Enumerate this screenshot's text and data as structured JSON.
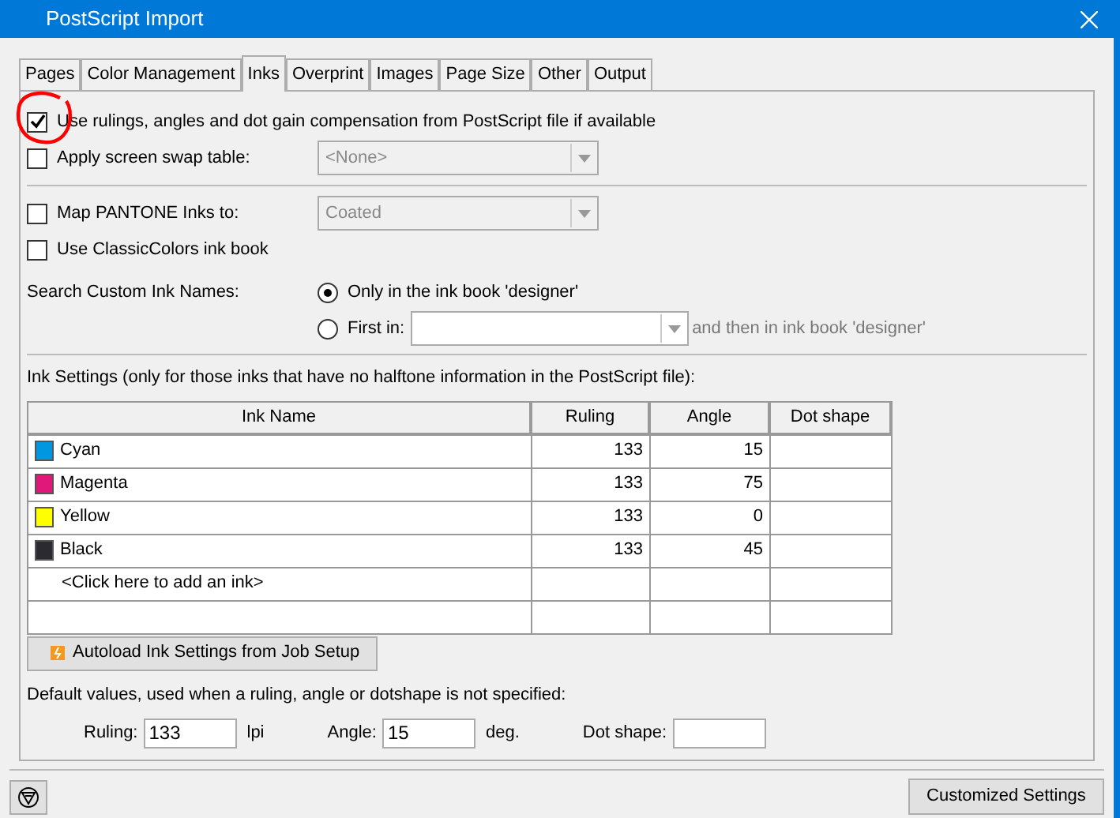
{
  "window": {
    "title": "PostScript Import"
  },
  "tabs": [
    {
      "label": "Pages",
      "selected": false
    },
    {
      "label": "Color Management",
      "selected": false
    },
    {
      "label": "Inks",
      "selected": true
    },
    {
      "label": "Overprint",
      "selected": false
    },
    {
      "label": "Images",
      "selected": false
    },
    {
      "label": "Page Size",
      "selected": false
    },
    {
      "label": "Other",
      "selected": false
    },
    {
      "label": "Output",
      "selected": false
    }
  ],
  "use_rulings": {
    "label": "Use rulings, angles and dot gain compensation from PostScript file if available",
    "checked": true
  },
  "screen_swap": {
    "label": "Apply screen swap table:",
    "checked": false,
    "dropdown": "<None>"
  },
  "map_pantone": {
    "label": "Map PANTONE Inks to:",
    "checked": false,
    "dropdown": "Coated"
  },
  "classic_colors": {
    "label": "Use ClassicColors ink book",
    "checked": false
  },
  "search_custom": {
    "label": "Search Custom Ink Names:",
    "options": [
      {
        "label": "Only in the ink book 'designer'",
        "selected": true
      },
      {
        "label": "First in:",
        "selected": false
      }
    ],
    "suffix": "and then in ink book 'designer'"
  },
  "ink_settings": {
    "label": "Ink Settings (only for those inks that have no halftone information in the PostScript file):",
    "columns": [
      "Ink Name",
      "Ruling",
      "Angle",
      "Dot shape"
    ],
    "rows": [
      {
        "name": "Cyan",
        "color": "#0096e0",
        "ruling": "133",
        "angle": "15"
      },
      {
        "name": "Magenta",
        "color": "#e0187a",
        "ruling": "133",
        "angle": "75"
      },
      {
        "name": "Yellow",
        "color": "#ffff00",
        "ruling": "133",
        "angle": "0"
      },
      {
        "name": "Black",
        "color": "#2a2a30",
        "ruling": "133",
        "angle": "45"
      }
    ],
    "add_row": "<Click here to add an ink>"
  },
  "autoload_button": "Autoload Ink Settings from Job Setup",
  "defaults": {
    "label": "Default values, used when a ruling, angle or dotshape is not specified:",
    "ruling_label": "Ruling:",
    "ruling": "133",
    "ruling_unit": "lpi",
    "angle_label": "Angle:",
    "angle": "15",
    "angle_unit": "deg.",
    "dot_label": "Dot shape:"
  },
  "customized_button": "Customized Settings",
  "annotation": {
    "kind": "circle",
    "color": "#ff0000"
  }
}
